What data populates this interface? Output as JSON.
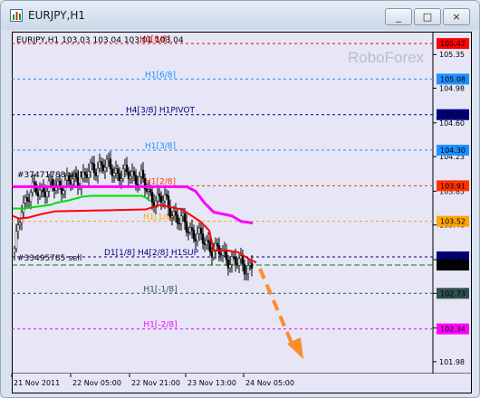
{
  "window": {
    "title": "EURJPY,H1"
  },
  "window_buttons": {
    "minimize": "_",
    "maximize": "□",
    "close": "×"
  },
  "colors": {
    "chart_bg": "#e6e6f7",
    "candles": "#000000",
    "ma_red": "#ff0000",
    "ma_magenta": "#ff00ff",
    "ma_green": "#00e000",
    "arrow": "#ff8c2a",
    "watermark": "#b9bdc7"
  },
  "chart": {
    "header": "EURJPY,H1  103.03 103.04 103.01 103.04",
    "watermark": "RoboForex",
    "ann_top": "#37471788 sell",
    "ann_bottom": "#33495785 sell",
    "current_price": "103.04"
  },
  "chart_data": {
    "type": "candlestick",
    "symbol": "EURJPY",
    "timeframe": "H1",
    "ylim": [
      101.85,
      105.6
    ],
    "y_ticks": [
      105.35,
      104.98,
      104.6,
      104.23,
      103.85,
      103.48,
      103.1,
      102.73,
      102.35,
      101.98
    ],
    "x_labels": [
      "21 Nov 2011",
      "22 Nov 05:00",
      "22 Nov 21:00",
      "23 Nov 13:00",
      "24 Nov 05:00"
    ],
    "levels": [
      {
        "label": "H1[8/8]",
        "value": 105.47,
        "color": "#ff0000",
        "tag": "105.47"
      },
      {
        "label": "H1[6/8]",
        "value": 105.08,
        "color": "#1e90ff",
        "tag": "105.08"
      },
      {
        "label": "H4[3/8] H1PIVOT",
        "value": 104.69,
        "color": "#000080",
        "tag": "104.69"
      },
      {
        "label": "H1[3/8]",
        "value": 104.3,
        "color": "#1e90ff",
        "tag": "104.30"
      },
      {
        "label": "H1[2/8]",
        "value": 103.91,
        "color": "#ff3300",
        "tag": "103.91"
      },
      {
        "label": "H1[1/8]",
        "value": 103.52,
        "color": "#ffa500",
        "tag": "103.52"
      },
      {
        "label": "D1[1/8] H4[2/8] H1SUP",
        "value": 103.13,
        "color": "#000080",
        "tag": "103.13"
      },
      {
        "label": "H1[-1/8]",
        "value": 102.73,
        "color": "#2f4f4f",
        "tag": "102.73"
      },
      {
        "label": "H1[-2/8]",
        "value": 102.34,
        "color": "#ff00ff",
        "tag": "102.34"
      }
    ],
    "current": {
      "value": 103.04
    }
  }
}
